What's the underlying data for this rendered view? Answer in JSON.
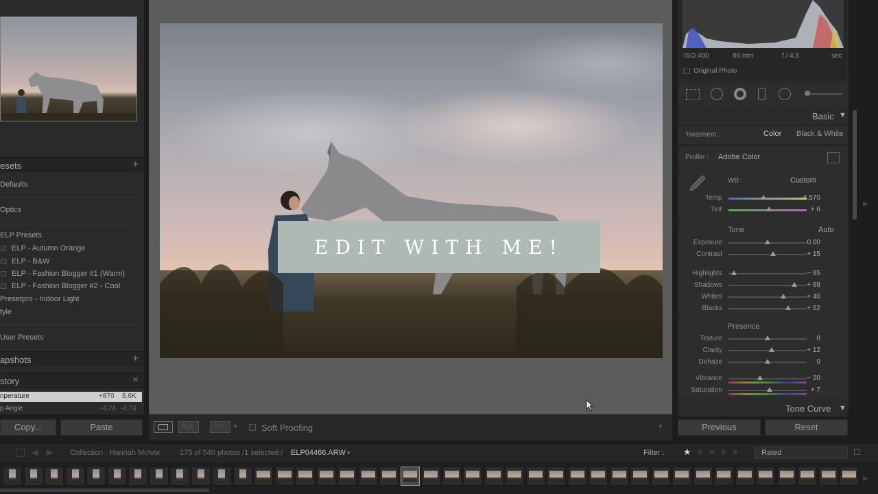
{
  "left_panel": {
    "presets_header": "esets",
    "presets_add": "+",
    "items": [
      {
        "label": "Defaults"
      },
      {
        "label": "Optics"
      },
      {
        "label": "ELP Presets"
      },
      {
        "label": "ELP - Autumn Orange"
      },
      {
        "label": "ELP - B&W"
      },
      {
        "label": "ELP - Fashion Blogger #1 (Warm)"
      },
      {
        "label": "ELP - Fashion Blogger #2 - Cool"
      },
      {
        "label": "Presetpro - Indoor Light"
      },
      {
        "label": "tyle"
      },
      {
        "label": "User Presets"
      }
    ],
    "snapshots_header": "apshots",
    "snapshots_add": "+",
    "history_header": "story",
    "history_close": "×",
    "history": [
      {
        "label": "nperature",
        "from": "+870",
        "to": "6.6K"
      },
      {
        "label": "p Angle",
        "from": "-4.74",
        "to": "-4.74"
      }
    ],
    "copy_label": "Copy...",
    "paste_label": "Paste"
  },
  "center": {
    "banner_text": "EDIT WITH ME!",
    "soft_proofing": "Soft Proofing"
  },
  "right_panel": {
    "histogram_info": {
      "iso": "ISO 400",
      "focal": "86 mm",
      "aperture": "f / 4.5",
      "shutter": "sec"
    },
    "original_photo": "Original Photo",
    "basic_header": "Basic",
    "treatment_label": "Treatment :",
    "treatment_color": "Color",
    "treatment_bw": "Black & White",
    "profile_label": "Profile :",
    "profile_value": "Adobe Color",
    "wb_label": "WB :",
    "wb_value": "Custom",
    "temp": {
      "label": "Temp",
      "value": "6,570",
      "pos": 0.45
    },
    "tint": {
      "label": "Tint",
      "value": "+ 6",
      "pos": 0.52
    },
    "tone_label": "Tone",
    "auto_label": "Auto",
    "tone_sliders": [
      {
        "label": "Exposure",
        "value": "0.00",
        "pos": 0.5
      },
      {
        "label": "Contrast",
        "value": "+ 15",
        "pos": 0.57
      }
    ],
    "tone_sliders2": [
      {
        "label": "Highlights",
        "value": "− 85",
        "pos": 0.07
      },
      {
        "label": "Shadows",
        "value": "+ 69",
        "pos": 0.84
      },
      {
        "label": "Whites",
        "value": "+ 40",
        "pos": 0.7
      },
      {
        "label": "Blacks",
        "value": "+ 52",
        "pos": 0.76
      }
    ],
    "presence_label": "Presence",
    "presence_sliders": [
      {
        "label": "Texture",
        "value": "0",
        "pos": 0.5
      },
      {
        "label": "Clarity",
        "value": "+ 12",
        "pos": 0.55
      },
      {
        "label": "Dehaze",
        "value": "0",
        "pos": 0.5
      }
    ],
    "presence_sliders2": [
      {
        "label": "Vibrance",
        "value": "− 20",
        "pos": 0.4
      },
      {
        "label": "Saturation",
        "value": "+ 7",
        "pos": 0.53
      }
    ],
    "tone_curve_header": "Tone Curve",
    "previous_label": "Previous",
    "reset_label": "Reset"
  },
  "filmbar": {
    "collection": "Collection : Hannah McIvor",
    "count": "175 of 540 photos /1 selected /",
    "filename": "ELP04466.ARW",
    "filter_label": "Filter :",
    "rated": "Rated"
  },
  "colors": {
    "banner": "#aeb9b3",
    "panel": "#2a2a2a",
    "center_bg": "#5c5c5c"
  }
}
